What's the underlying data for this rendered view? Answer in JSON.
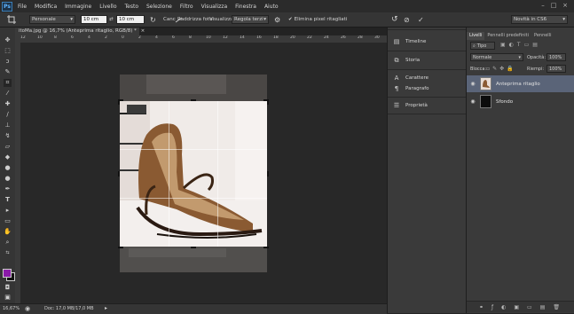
{
  "menu": {
    "logo": "Ps",
    "items": [
      "File",
      "Modifica",
      "Immagine",
      "Livello",
      "Testo",
      "Selezione",
      "Filtro",
      "Visualizza",
      "Finestra",
      "Aiuto"
    ]
  },
  "window_controls": {
    "minimize": "–",
    "maximize": "□",
    "close": "×"
  },
  "options": {
    "preset": "Personale",
    "width": "10 cm",
    "height": "10 cm",
    "clear": "Canc",
    "straighten": "Raddrizza foto",
    "view_label": "Visualizza:",
    "view_value": "Regola terzi",
    "delete_cropped": "Elimina pixel ritagliati",
    "workspace": "Novità in CS6"
  },
  "document": {
    "tab_label": "itoMa.jpg @ 16,7% (Anteprima ritaglio, RGB/8) *"
  },
  "ruler": {
    "ticks": [
      "12",
      "10",
      "8",
      "6",
      "4",
      "2",
      "0",
      "2",
      "4",
      "6",
      "8",
      "10",
      "12",
      "14",
      "16",
      "18",
      "20",
      "22",
      "24",
      "26",
      "28",
      "30"
    ]
  },
  "status": {
    "zoom": "16,67%",
    "doc": "Doc: 17,0 MB/17,0 MB"
  },
  "mid_panel": {
    "items": [
      {
        "label": "Timeline",
        "icon": "timeline-icon"
      },
      {
        "label": "Storia",
        "icon": "history-icon"
      },
      {
        "label": "Carattere",
        "icon": "character-icon"
      },
      {
        "label": "Paragrafo",
        "icon": "paragraph-icon"
      },
      {
        "label": "Proprietà",
        "icon": "properties-icon"
      }
    ]
  },
  "layers_panel": {
    "tabs": [
      "Livelli",
      "Pennelli predefiniti",
      "Pennelli"
    ],
    "kind": "Tipo",
    "blend_mode": "Normale",
    "opacity_label": "Opacità:",
    "opacity_value": "100%",
    "lock_label": "Blocca:",
    "fill_label": "Riempi:",
    "fill_value": "100%",
    "layers": [
      {
        "name": "Anteprima ritaglio",
        "selected": true
      },
      {
        "name": "Sfondo",
        "selected": false
      }
    ]
  },
  "colors": {
    "foreground": "#8a1aa8",
    "background": "#111111",
    "accent": "#5fb4ff"
  }
}
